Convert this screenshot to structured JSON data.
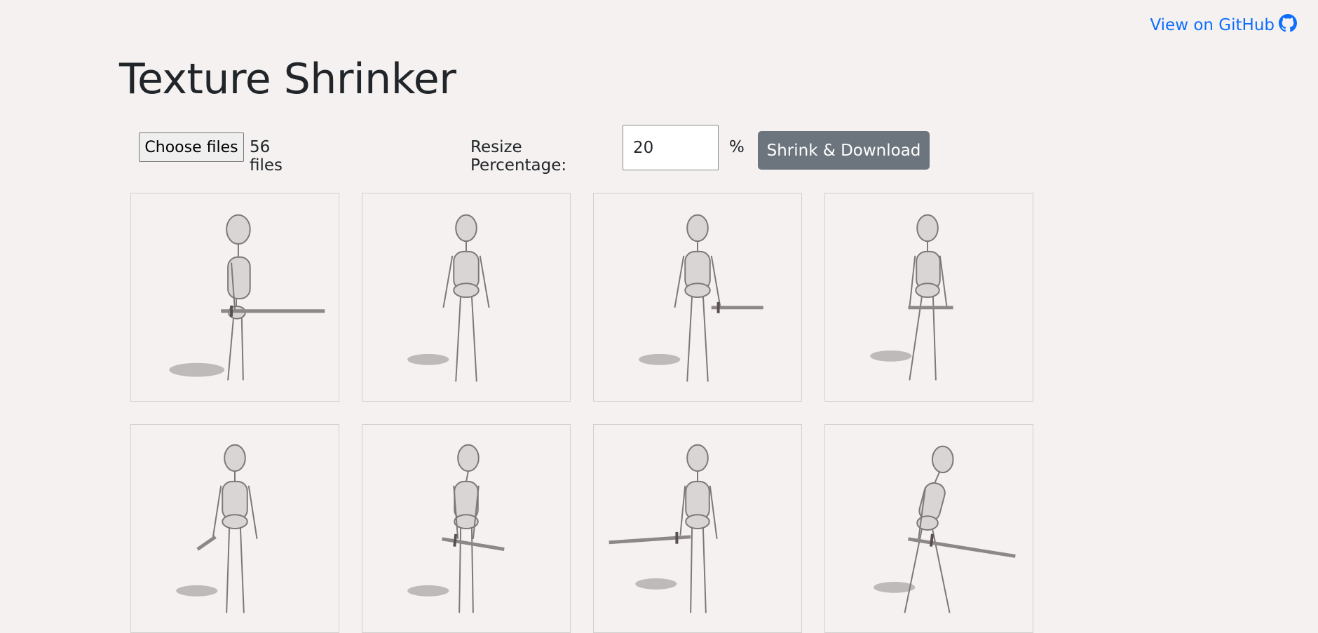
{
  "header": {
    "github_label": "View on GitHub",
    "github_icon": "github-icon",
    "title": "Texture Shrinker"
  },
  "controls": {
    "choose_files_label": "Choose files",
    "file_count": "56 files",
    "resize_label": "Resize Percentage:",
    "resize_value": "20",
    "percent_sign": "%",
    "shrink_label": "Shrink & Download"
  },
  "colors": {
    "accent": "#0d6efd",
    "button": "#6c757d",
    "background": "#f4f1f0"
  },
  "thumbnails": [
    {
      "name": "skeleton-sword-side-right"
    },
    {
      "name": "skeleton-back-view"
    },
    {
      "name": "skeleton-back-sword-right"
    },
    {
      "name": "skeleton-back-quarter"
    },
    {
      "name": "skeleton-front-dagger-left"
    },
    {
      "name": "skeleton-front-sword-low"
    },
    {
      "name": "skeleton-front-sword-left"
    },
    {
      "name": "skeleton-side-walk-sword"
    }
  ]
}
